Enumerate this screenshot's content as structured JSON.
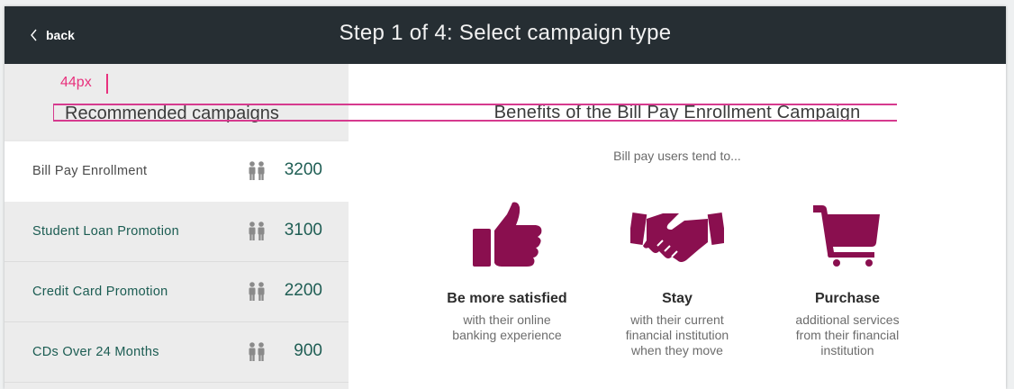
{
  "header": {
    "back_label": "back",
    "title": "Step 1 of 4: Select campaign type"
  },
  "annotation": {
    "measure_label": "44px"
  },
  "left": {
    "title": "Recommended campaigns",
    "campaigns": [
      {
        "name": "Bill Pay Enrollment",
        "count": "3200",
        "icon": "people-icon",
        "active": true
      },
      {
        "name": "Student Loan Promotion",
        "count": "3100",
        "icon": "people-icon",
        "active": false
      },
      {
        "name": "Credit Card Promotion",
        "count": "2200",
        "icon": "people-icon",
        "active": false
      },
      {
        "name": "CDs Over 24 Months",
        "count": "900",
        "icon": "people-icon",
        "active": false
      }
    ]
  },
  "right": {
    "title": "Benefits of the Bill Pay Enrollment Campaign",
    "subtitle": "Bill pay users tend to...",
    "benefits": [
      {
        "icon": "thumbs-up-icon",
        "title": "Be more satisfied",
        "desc_lines": [
          "with their online",
          "banking experience"
        ]
      },
      {
        "icon": "handshake-icon",
        "title": "Stay",
        "desc_lines": [
          "with their current",
          "financial institution",
          "when they move"
        ]
      },
      {
        "icon": "shopping-cart-icon",
        "title": "Purchase",
        "desc_lines": [
          "additional services",
          "from their financial",
          "institution"
        ]
      }
    ]
  },
  "colors": {
    "topbar": "#262e33",
    "accent_green": "#1f5e54",
    "icon_magenta": "#8a0f4f",
    "guide_pink": "#d63a8e"
  }
}
